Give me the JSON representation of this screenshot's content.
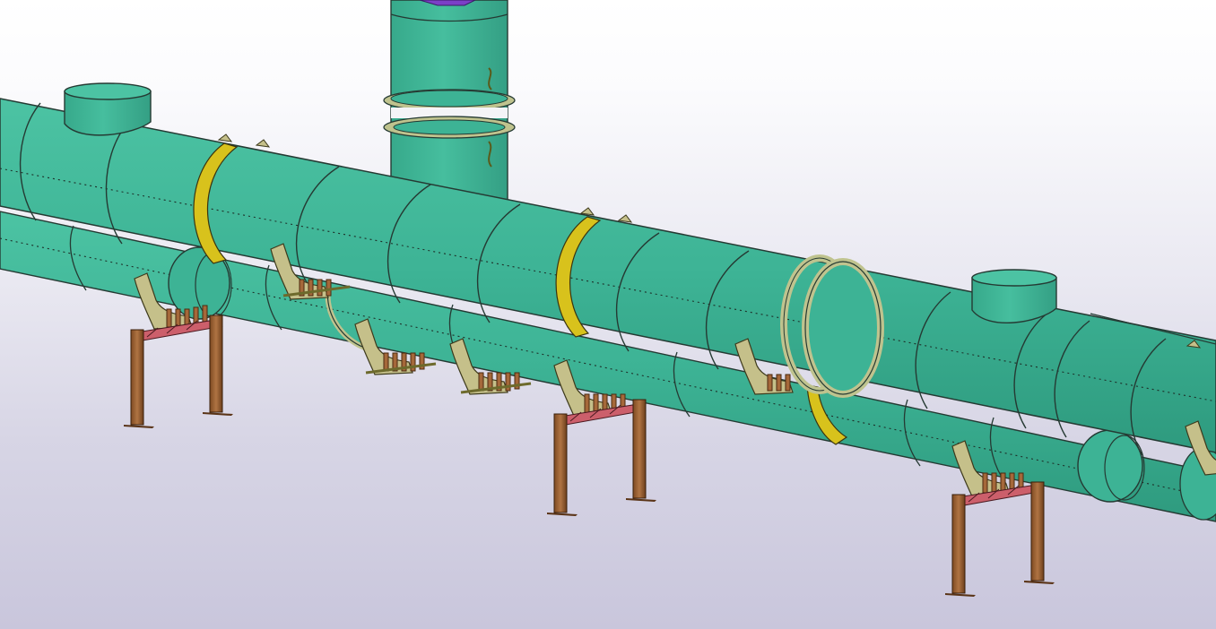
{
  "viewer": {
    "background": {
      "top": "#ffffff",
      "bottom": "#c9c6dc"
    }
  },
  "colors": {
    "pipe": "#3fb597",
    "pipe_dark": "#2f9a7f",
    "pipe_light": "#55c9a9",
    "outline": "#253a33",
    "yellow_band": "#d8c21c",
    "flange": "#bfc38e",
    "support_plate": "#c5c08a",
    "leg": "#a5683a",
    "leg_dark": "#5a3417",
    "beam": "#cc5f6b",
    "bolt": "#8a5a34",
    "purple_cap": "#7b3fc7"
  },
  "model": {
    "main_pipe": "pipe-main-upper",
    "lower_pipe": "pipe-main-lower",
    "nozzles": [
      "nozzle-left",
      "nozzle-right"
    ],
    "vertical_branch": "branch-vertical",
    "supports": [
      "support-1",
      "support-2",
      "support-3",
      "support-4",
      "support-5",
      "support-6"
    ],
    "frames": [
      "frame-1",
      "frame-2",
      "frame-3"
    ],
    "yellow_bands": [
      "band-1",
      "band-2",
      "band-3"
    ]
  }
}
